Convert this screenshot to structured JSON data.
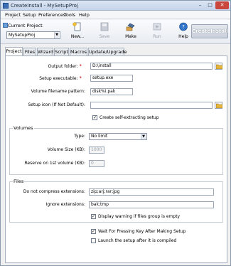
{
  "window": {
    "title": "CreateInstall - MySetupProj",
    "min_glyph": "–",
    "max_glyph": "□",
    "close_glyph": "✕"
  },
  "menu": [
    "Project",
    "Setup",
    "Preferences",
    "Tools",
    "Help"
  ],
  "toolbar": {
    "current_project_label": "Current Project",
    "current_project_value": "MySetupProj",
    "new_label": "New...",
    "save_label": "Save",
    "make_label": "Make",
    "run_label": "Run",
    "help_label": "Help",
    "createinstall_label": "CreateInstall"
  },
  "tabs": [
    "Project",
    "Files",
    "Wizard",
    "Script",
    "Macros",
    "Update/Upgrade"
  ],
  "project": {
    "output_folder_label": "Output folder:",
    "output_folder_value": "D:\\install",
    "setup_exe_label": "Setup executable:",
    "setup_exe_value": "setup.exe",
    "volume_pattern_label": "Volume filename pattern:",
    "volume_pattern_value": "disk%i.pak",
    "setup_icon_label": "Setup icon (If Not Default):",
    "setup_icon_value": "",
    "self_extract_label": "Create self-extracting setup",
    "required_mark": "*"
  },
  "volumes": {
    "title": "Volumes",
    "type_label": "Type:",
    "type_value": "No limit",
    "size_label": "Volume Size (KB):",
    "size_value": "1000",
    "reserve_label": "Reserve on 1st volume (KB):",
    "reserve_value": "0"
  },
  "files": {
    "title": "Files",
    "no_compress_label": "Do not compress extensions:",
    "no_compress_value": "zip;arj;rar;jpg",
    "ignore_label": "Ignore extensions:",
    "ignore_value": "bak;tmp",
    "warning_label": "Display warning if files group is empty"
  },
  "footer": {
    "wait_label": "Wait For Pressing Key After Making Setup",
    "launch_label": "Launch the setup after it is compiled"
  },
  "check_glyph": "✓"
}
